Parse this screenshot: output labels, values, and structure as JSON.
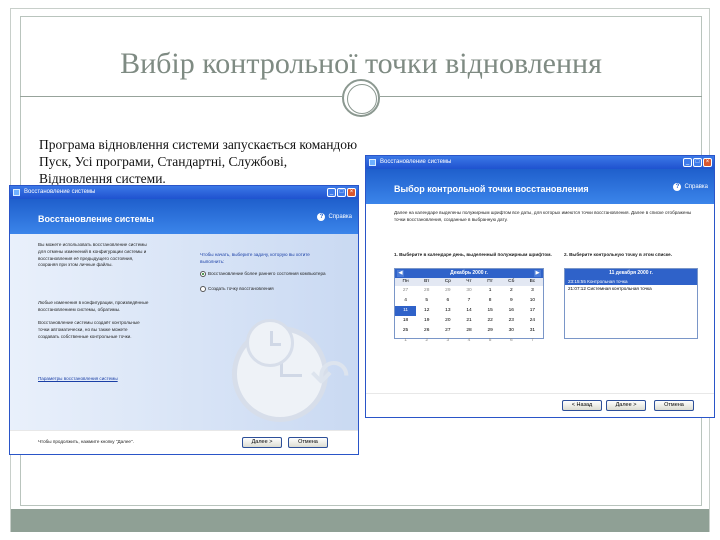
{
  "slide": {
    "title": "Вибір контрольної точки відновлення",
    "body_text": "Програма відновлення системи запускається командою Пуск, Усі програми, Стандартні, Службові, Відновлення системи."
  },
  "colors": {
    "accent_band": "#8fa095",
    "xp_blue": "#2f62c9",
    "title_gray": "#7f8b83"
  },
  "left_window": {
    "titlebar": "Восстановление системы",
    "header_title": "Восстановление системы",
    "help_label": "Справка",
    "intro_lines": [
      "Вы можете использовать восстановление системы",
      "для отмены изменений в конфигурации системы и",
      "восстановления её предыдущего состояния,",
      "сохраняя при этом личные файлы."
    ],
    "text2_lines": [
      "Любые изменения в конфигурации, произведённые",
      "восстановлением системы, обратимы."
    ],
    "text3_lines": [
      "Восстановление системы создаёт контрольные",
      "точки автоматически, но вы также можете",
      "создавать собственные контрольные точки."
    ],
    "link_text": "Параметры восстановления системы",
    "question": "Чтобы начать, выберите задачу, которую вы хотите выполнить:",
    "options": [
      {
        "label": "Восстановление более раннего состояния компьютера",
        "selected": true
      },
      {
        "label": "Создать точку восстановления",
        "selected": false
      }
    ],
    "footer_text": "Чтобы продолжить, нажмите кнопку \"Далее\".",
    "next_button": "Далее >",
    "cancel_button": "Отмена",
    "icons": [
      "restore-app-icon",
      "help-icon",
      "clock-watermark-icon",
      "arrow-watermark-icon"
    ]
  },
  "right_window": {
    "titlebar": "Восстановление системы",
    "header_title": "Выбор контрольной точки восстановления",
    "help_label": "Справка",
    "intro": "Далее на календаре выделены полужирным шрифтом все даты, для которых имеются точки восстановления. Далее в списке отображены точки восстановления, созданные в выбранную дату.",
    "step1": "1. Выберите в календаре день, выделенный полужирным шрифтом.",
    "step2": "2. Выберите контрольную точку в этом списке.",
    "calendar": {
      "month_label": "Декабрь 2000 г.",
      "weekdays": [
        "Пн",
        "Вт",
        "Ср",
        "Чт",
        "Пт",
        "Сб",
        "Вс"
      ],
      "days": [
        "27",
        "28",
        "29",
        "30",
        "1",
        "2",
        "3",
        "4",
        "5",
        "6",
        "7",
        "8",
        "9",
        "10",
        "11",
        "12",
        "13",
        "14",
        "15",
        "16",
        "17",
        "18",
        "19",
        "20",
        "21",
        "22",
        "23",
        "24",
        "25",
        "26",
        "27",
        "28",
        "29",
        "30",
        "31",
        "1",
        "2",
        "3",
        "4",
        "5",
        "6",
        "7"
      ],
      "selected_day": "11"
    },
    "list": {
      "date_label": "11 декабря 2000 г.",
      "items": [
        {
          "label": "23:15:55  Контрольная точка",
          "selected": true
        },
        {
          "label": "21:07:12  Системная контрольная точка",
          "selected": false
        }
      ]
    },
    "back_button": "< Назад",
    "next_button": "Далее >",
    "cancel_button": "Отмена"
  }
}
